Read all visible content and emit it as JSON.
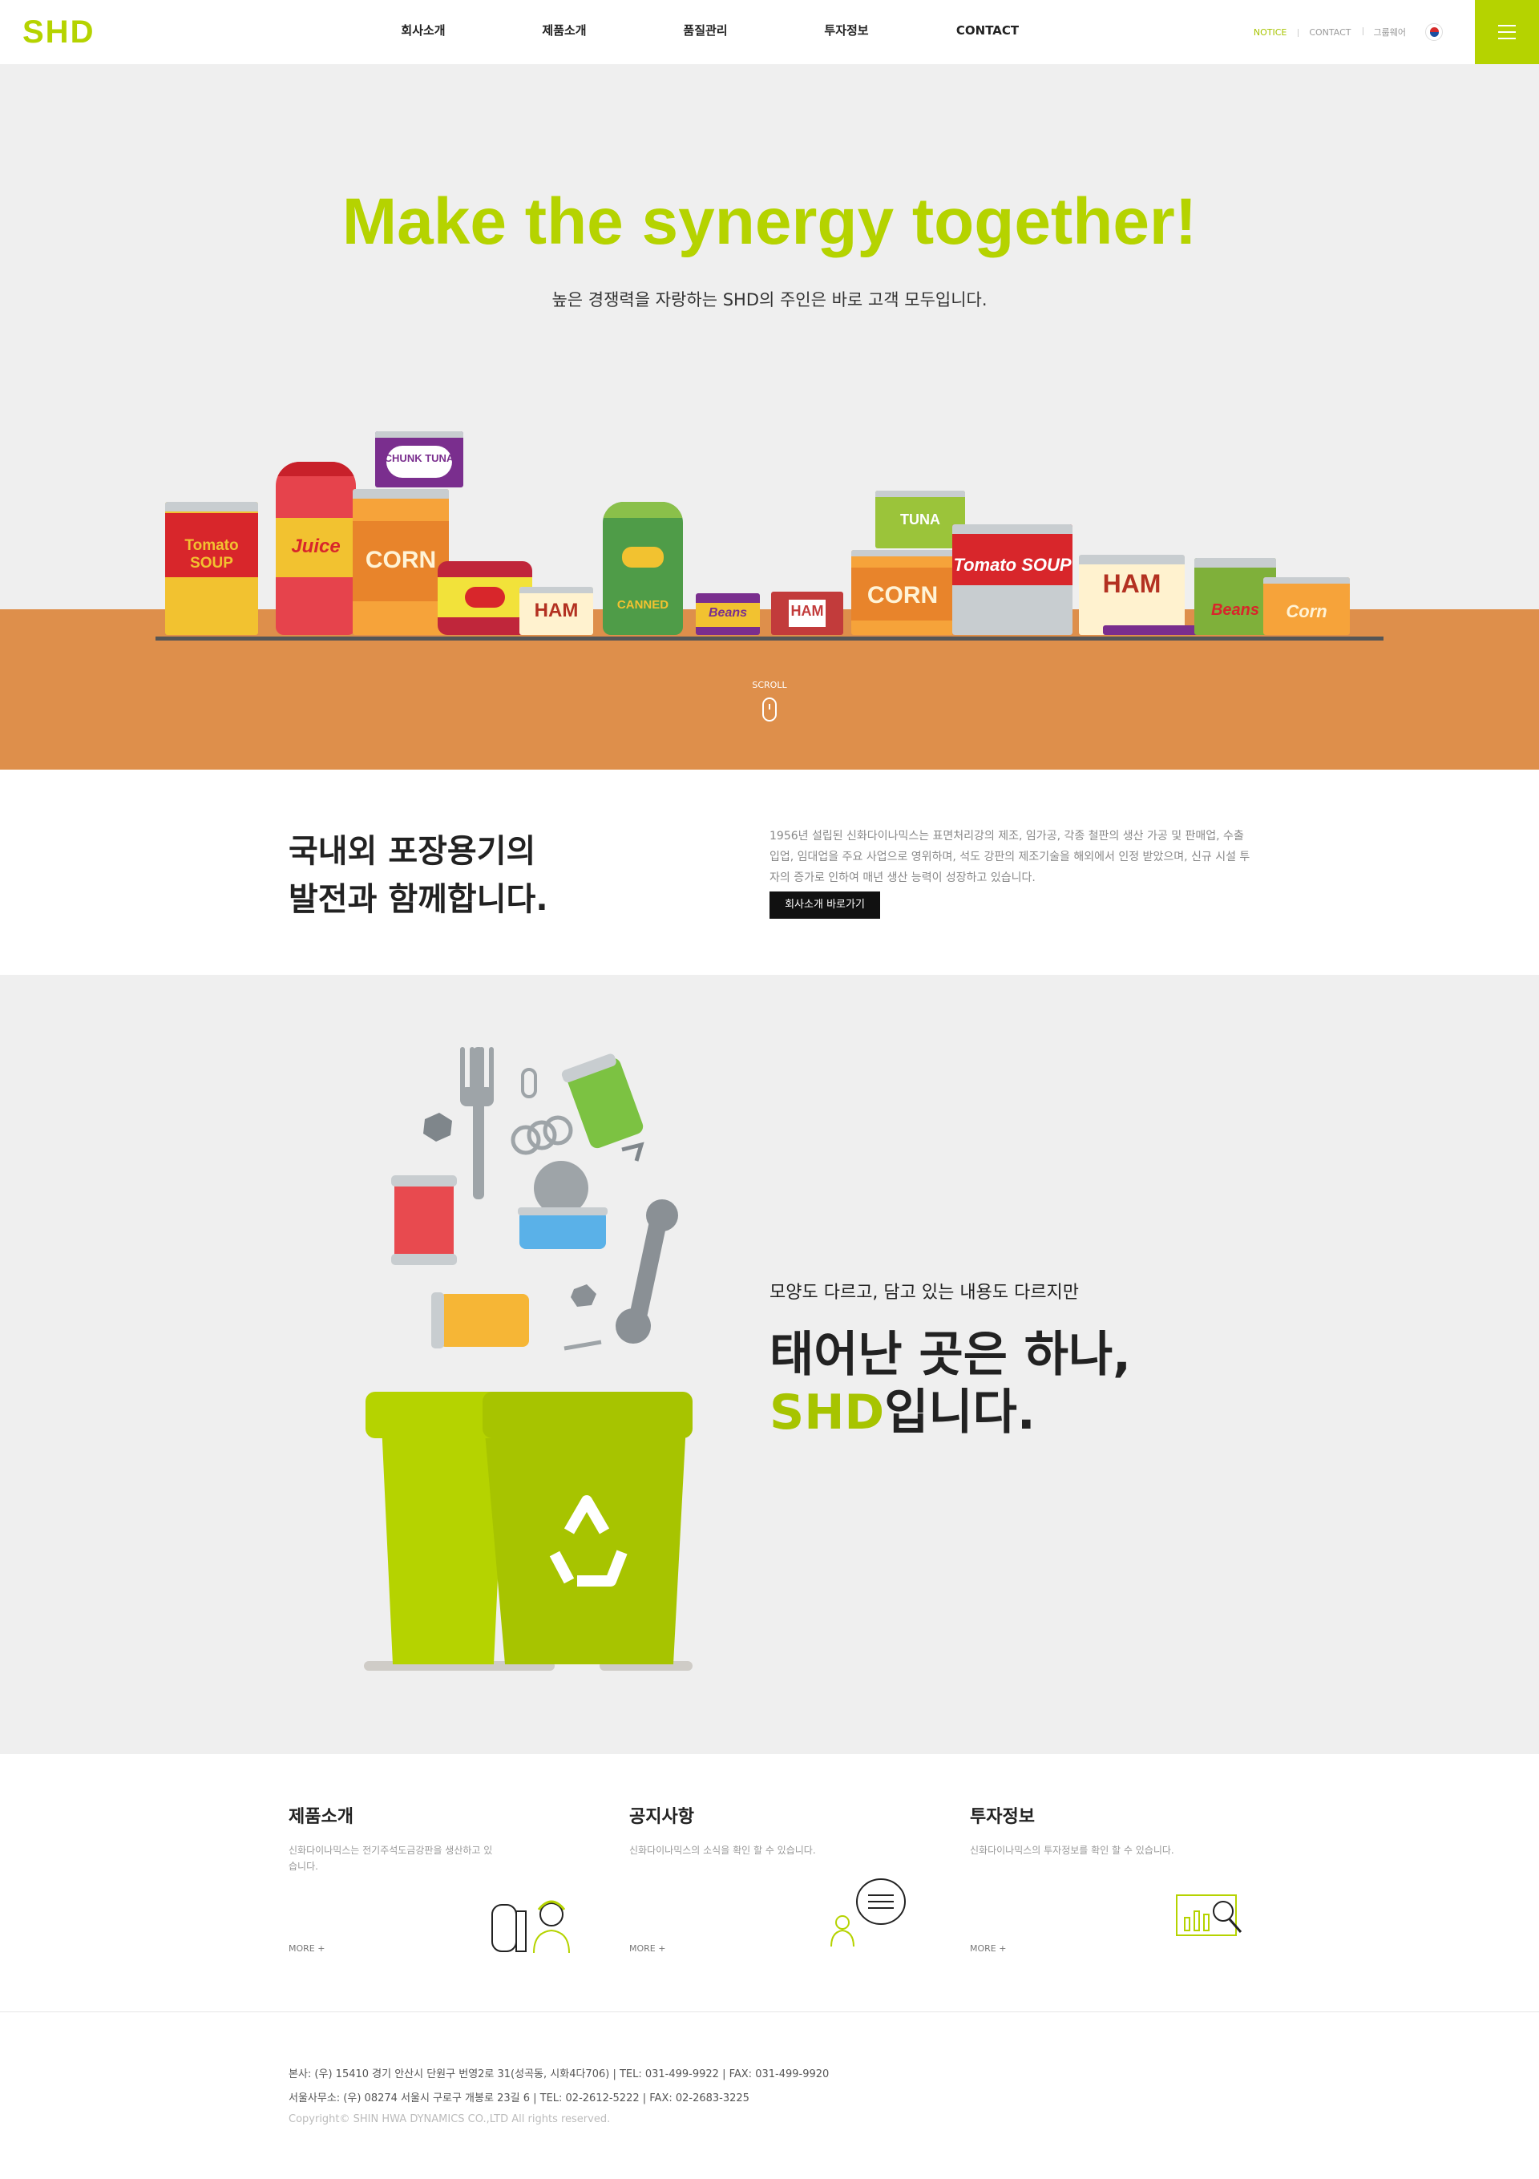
{
  "header": {
    "logo": "SHD",
    "nav": [
      "회사소개",
      "제품소개",
      "품질관리",
      "투자정보",
      "CONTACT"
    ],
    "util": [
      "NOTICE",
      "CONTACT",
      "그룹웨어"
    ],
    "accent_color": "#b5d300",
    "menu_icon": "hamburger-icon",
    "language_icon": "korea-flag-icon"
  },
  "hero": {
    "title": "Make the synergy together!",
    "subtitle": "높은 경쟁력을 자랑하는 SHD의 주인은 바로 고객 모두입니다.",
    "scroll_label": "SCROLL",
    "cans": [
      "Tomato SOUP",
      "Juice",
      "CORN",
      "CHUNK TUNA",
      "HAM",
      "CHUNK TUNA",
      "CANNED",
      "Beans",
      "HAM",
      "TUNA",
      "CORN",
      "Tomato SOUP",
      "HAM",
      "CHUNK TUNA",
      "Beans",
      "Corn"
    ]
  },
  "intro": {
    "title_line1": "국내외 포장용기의",
    "title_line2": "발전과 함께합니다.",
    "desc": "1956년 설립된 신화다이나믹스는 표면처리강의 제조, 임가공, 각종 철판의 생산 가공 및 판매업, 수출입업, 임대업을 주요 사업으로 영위하며, 석도 강판의 제조기술을 해외에서 인정 받았으며, 신규 시설 투자의 증가로 인하여 매년 생산 능력이 성장하고 있습니다.",
    "button": "회사소개 바로가기"
  },
  "recycle": {
    "subtitle": "모양도 다르고, 담고 있는 내용도 다르지만",
    "title_line1": "태어난 곳은 하나,",
    "title_accent": "SHD",
    "title_rest": "입니다."
  },
  "cards": [
    {
      "title": "제품소개",
      "desc": "신화다이나믹스는 전기주석도금강판을 생산하고 있습니다.",
      "more": "MORE +",
      "icon": "worker-roll-icon"
    },
    {
      "title": "공지사항",
      "desc": "신화다이나믹스의 소식을 확인 할 수 있습니다.",
      "more": "MORE +",
      "icon": "chat-bubble-icon"
    },
    {
      "title": "투자정보",
      "desc": "신화다이나믹스의 투자정보를 확인 할 수 있습니다.",
      "more": "MORE +",
      "icon": "chart-search-icon"
    }
  ],
  "footer": {
    "line1": "본사: (우) 15410 경기 안산시 단원구 번영2로 31(성곡동, 시화4다706) | TEL: 031-499-9922 | FAX: 031-499-9920",
    "line2": "서울사무소: (우) 08274 서울시 구로구 개봉로 23길 6 | TEL: 02-2612-5222 | FAX: 02-2683-3225",
    "copyright": "Copyright© SHIN HWA DYNAMICS CO.,LTD All rights reserved."
  }
}
